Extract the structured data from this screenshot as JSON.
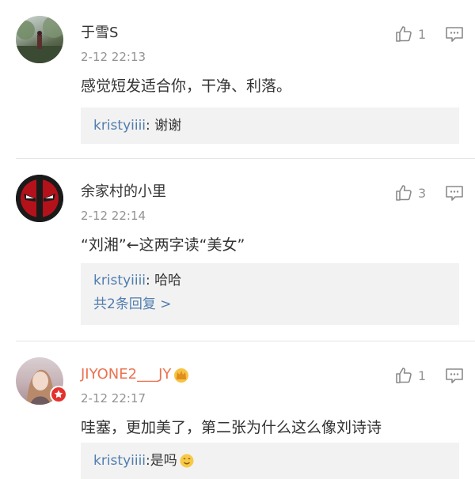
{
  "comments": [
    {
      "username": "于雪S",
      "time": "2-12 22:13",
      "likes": "1",
      "text": "感觉短发适合你，干净、利落。",
      "replies": [
        {
          "name": "kristyiiii",
          "sep": ":",
          "text": " 谢谢"
        }
      ]
    },
    {
      "username": "余家村的小里",
      "time": "2-12 22:14",
      "likes": "3",
      "text": "“刘湘”←这两字读“美女”",
      "replies": [
        {
          "name": "kristyiiii",
          "sep": ":",
          "text": " 哈哈"
        }
      ],
      "more": "共2条回复 >"
    },
    {
      "username": "JIYONE2___JY",
      "time": "2-12 22:17",
      "likes": "1",
      "text": "哇塞，更加美了，第二张为什么这么像刘诗诗",
      "replies": [
        {
          "name": "kristyiiii",
          "sep": ":",
          "text": " 是吗"
        }
      ]
    }
  ],
  "icons": {
    "like": "thumbs-up-icon",
    "reply": "comment-icon",
    "vip": "crown-icon",
    "verified": "verified-badge-icon",
    "emoji": "emoji-icon"
  },
  "colors": {
    "link": "#507daf",
    "vip_name": "#eb7350",
    "muted": "#939393",
    "reply_bg": "#f2f2f2"
  }
}
